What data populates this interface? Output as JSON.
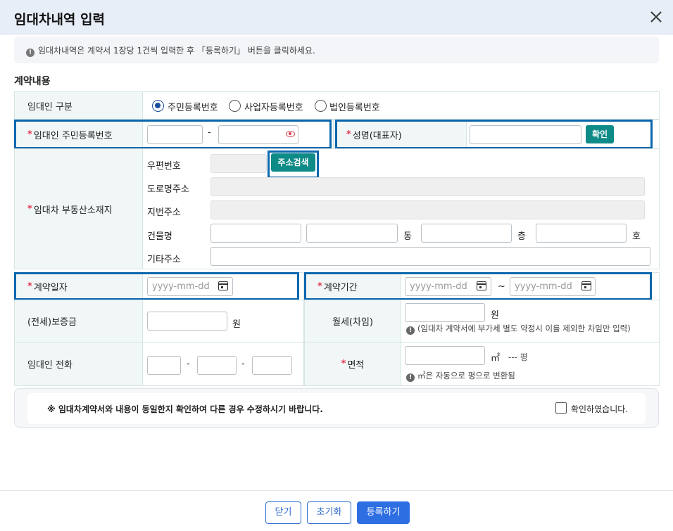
{
  "dialog": {
    "title": "임대차내역 입력"
  },
  "notice": "임대차내역은 계약서 1장당 1건씩 입력한 후 「등록하기」 버튼을 클릭하세요.",
  "section_title": "계약내용",
  "lessor_type": {
    "label": "임대인 구분",
    "options": [
      "주민등록번호",
      "사업자등록번호",
      "법인등록번호"
    ],
    "selected": "주민등록번호"
  },
  "resident_no": {
    "label": "임대인 주민등록번호",
    "sep": "-"
  },
  "name": {
    "label": "성명(대표자)",
    "button": "확인"
  },
  "address": {
    "label": "임대차 부동산소재지",
    "postal_label": "우편번호",
    "search_button": "주소검색",
    "road_label": "도로명주소",
    "lot_label": "지번주소",
    "building_label": "건물명",
    "dong": "동",
    "floor": "층",
    "ho": "호",
    "etc_label": "기타주소"
  },
  "contract_date": {
    "label": "계약일자",
    "placeholder": "yyyy-mm-dd"
  },
  "contract_period": {
    "label": "계약기간",
    "start_placeholder": "yyyy-mm-dd",
    "end_placeholder": "yyyy-mm-dd",
    "tilde": "~"
  },
  "deposit": {
    "label": "(전세)보증금",
    "unit": "원"
  },
  "rent": {
    "label": "월세(차임)",
    "unit": "원",
    "note": "(임대차 계약서에 부가세 별도 약정시 이를 제외한 차임만 입력)"
  },
  "phone": {
    "label": "임대인 전화",
    "sep1": "-",
    "sep2": "-"
  },
  "area": {
    "label": "면적",
    "unit": "㎡",
    "pyeong": "--- 평",
    "note": "㎡은 자동으로 평으로 변환됨"
  },
  "confirm": {
    "text": "※ 임대차계약서와 내용이 동일한지 확인하여 다른 경우 수정하시기 바랍니다.",
    "checkbox": "확인하였습니다."
  },
  "footer": {
    "close": "닫기",
    "reset": "초기화",
    "register": "등록하기"
  },
  "colors": {
    "accent": "#2e6ee3",
    "teal": "#0e8a87",
    "highlight": "#0b67ad",
    "required": "#e0334b"
  }
}
